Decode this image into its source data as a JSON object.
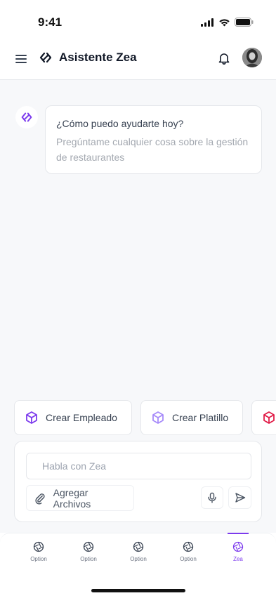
{
  "status_bar": {
    "time": "9:41"
  },
  "header": {
    "title": "Asistente Zea",
    "brand_icon": "link-code-icon",
    "menu_icon": "hamburger-menu-icon",
    "notification_icon": "bell-icon"
  },
  "chat": {
    "messages": [
      {
        "sender": "bot",
        "title": "¿Cómo puedo ayudarte hoy?",
        "subtitle": "Pregúntame cualquier cosa sobre la gestión de restaurantes"
      }
    ]
  },
  "quick_actions": [
    {
      "label": "Crear Empleado",
      "icon": "cube-icon",
      "color": "#7c3aed"
    },
    {
      "label": "Crear Platillo",
      "icon": "cube-icon",
      "color": "#a78bfa"
    },
    {
      "label": "",
      "icon": "cube-icon",
      "color": "#e11d48"
    }
  ],
  "composer": {
    "placeholder": "Habla con Zea",
    "attach_label": "Agregar Archivos"
  },
  "bottom_nav": {
    "items": [
      {
        "label": "Option",
        "active": false
      },
      {
        "label": "Option",
        "active": false
      },
      {
        "label": "Option",
        "active": false
      },
      {
        "label": "Option",
        "active": false
      },
      {
        "label": "Zea",
        "active": true
      }
    ]
  },
  "colors": {
    "accent": "#7c3aed",
    "background": "#f7f8fa",
    "border": "#e5e7eb"
  }
}
